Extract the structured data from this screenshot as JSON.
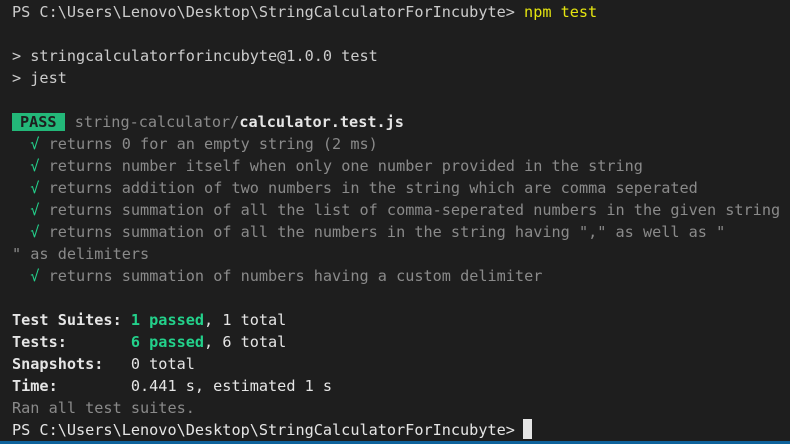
{
  "prompt1": {
    "path": "PS C:\\Users\\Lenovo\\Desktop\\StringCalculatorForIncubyte> ",
    "cmd": "npm test"
  },
  "script_lines": [
    "> stringcalculatorforincubyte@1.0.0 test",
    "> jest"
  ],
  "result": {
    "badge": "PASS",
    "dir": "string-calculator/",
    "file": "calculator.test.js"
  },
  "tests": [
    {
      "check": "√",
      "text": "returns 0 for an empty string (2 ms)"
    },
    {
      "check": "√",
      "text": "returns number itself when only one number provided in the string"
    },
    {
      "check": "√",
      "text": "returns addition of two numbers in the string which are comma seperated"
    },
    {
      "check": "√",
      "text": "returns summation of all the list of comma-seperated numbers in the given string"
    },
    {
      "check": "√",
      "text": "returns summation of all the numbers in the string having \",\" as well as \""
    },
    {
      "check": "",
      "text": "\" as delimiters"
    },
    {
      "check": "√",
      "text": "returns summation of numbers having a custom delimiter"
    }
  ],
  "summary": {
    "suites": {
      "label": "Test Suites: ",
      "passed": "1 passed",
      "rest": ", 1 total"
    },
    "tests": {
      "label": "Tests:       ",
      "passed": "6 passed",
      "rest": ", 6 total"
    },
    "snapshots": {
      "label": "Snapshots:   ",
      "value": "0 total"
    },
    "time": {
      "label": "Time:        ",
      "value": "0.441 s, estimated 1 s"
    },
    "ran": "Ran all test suites."
  },
  "prompt2": {
    "path": "PS C:\\Users\\Lenovo\\Desktop\\StringCalculatorForIncubyte>"
  },
  "colors": {
    "background": "#1e1e1e",
    "pass_badge": "#23b879",
    "success": "#23d18b",
    "command": "#e5e510"
  }
}
